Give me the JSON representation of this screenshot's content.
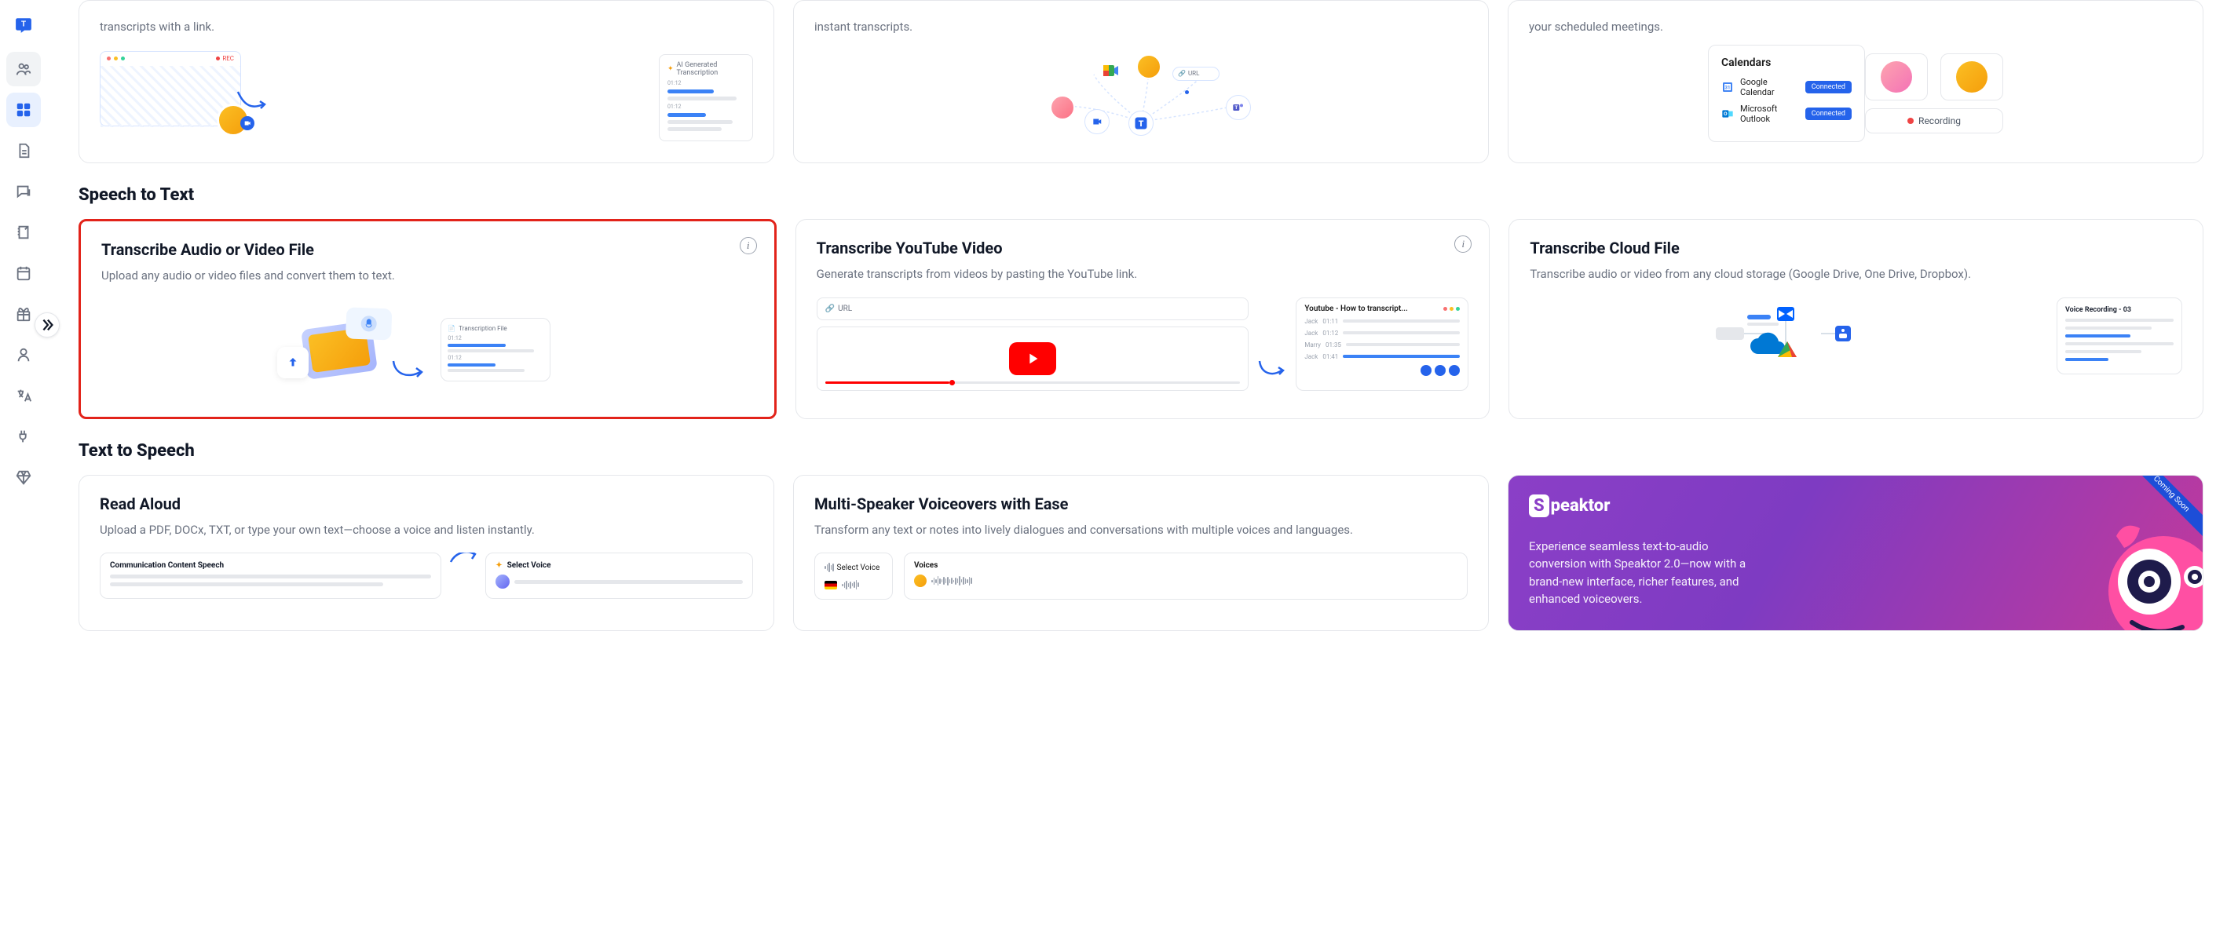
{
  "sidebar": {
    "logo_letter": "T"
  },
  "top_row": {
    "card1_desc": "transcripts with a link.",
    "card1_ill_title": "AI Generated Transcription",
    "card1_rec": "REC",
    "card2_desc": "instant transcripts.",
    "card2_url": "URL",
    "card3_desc": "your scheduled meetings.",
    "calendars_title": "Calendars",
    "gcal": "Google Calendar",
    "outlook": "Microsoft Outlook",
    "connected": "Connected",
    "recording": "Recording"
  },
  "sections": {
    "stt": "Speech to Text",
    "tts": "Text to Speech"
  },
  "stt": {
    "c1_title": "Transcribe Audio or Video File",
    "c1_desc": "Upload any audio or video files and convert them to text.",
    "c1_trans_file": "Transcription File",
    "c2_title": "Transcribe YouTube Video",
    "c2_desc": "Generate transcripts from videos by pasting the YouTube link.",
    "c2_url": "URL",
    "c2_yt_title": "Youtube - How to transcript...",
    "c2_names": [
      "Jack",
      "Jack",
      "Marry",
      "Jack"
    ],
    "c2_times": [
      "01:11",
      "01:12",
      "01:35",
      "01:41"
    ],
    "c3_title": "Transcribe Cloud File",
    "c3_desc": "Transcribe audio or video from any cloud storage (Google Drive, One Drive, Dropbox).",
    "c3_voice": "Voice Recording - 03"
  },
  "tts": {
    "c1_title": "Read Aloud",
    "c1_desc": "Upload a PDF, DOCx, TXT, or type your own text—choose a voice and listen instantly.",
    "c1_comm": "Communication Content Speech",
    "c1_select": "Select Voice",
    "c2_title": "Multi-Speaker Voiceovers with Ease",
    "c2_desc": "Transform any text or notes into lively dialogues and conversations with multiple voices and languages.",
    "c2_sv": "Select Voice",
    "c2_voices": "Voices",
    "c3_logo": "peaktor",
    "c3_desc": "Experience seamless text-to-audio conversion with Speaktor 2.0—now with a brand-new interface, richer features, and enhanced voiceovers.",
    "c3_ribbon": "Coming Soon"
  }
}
